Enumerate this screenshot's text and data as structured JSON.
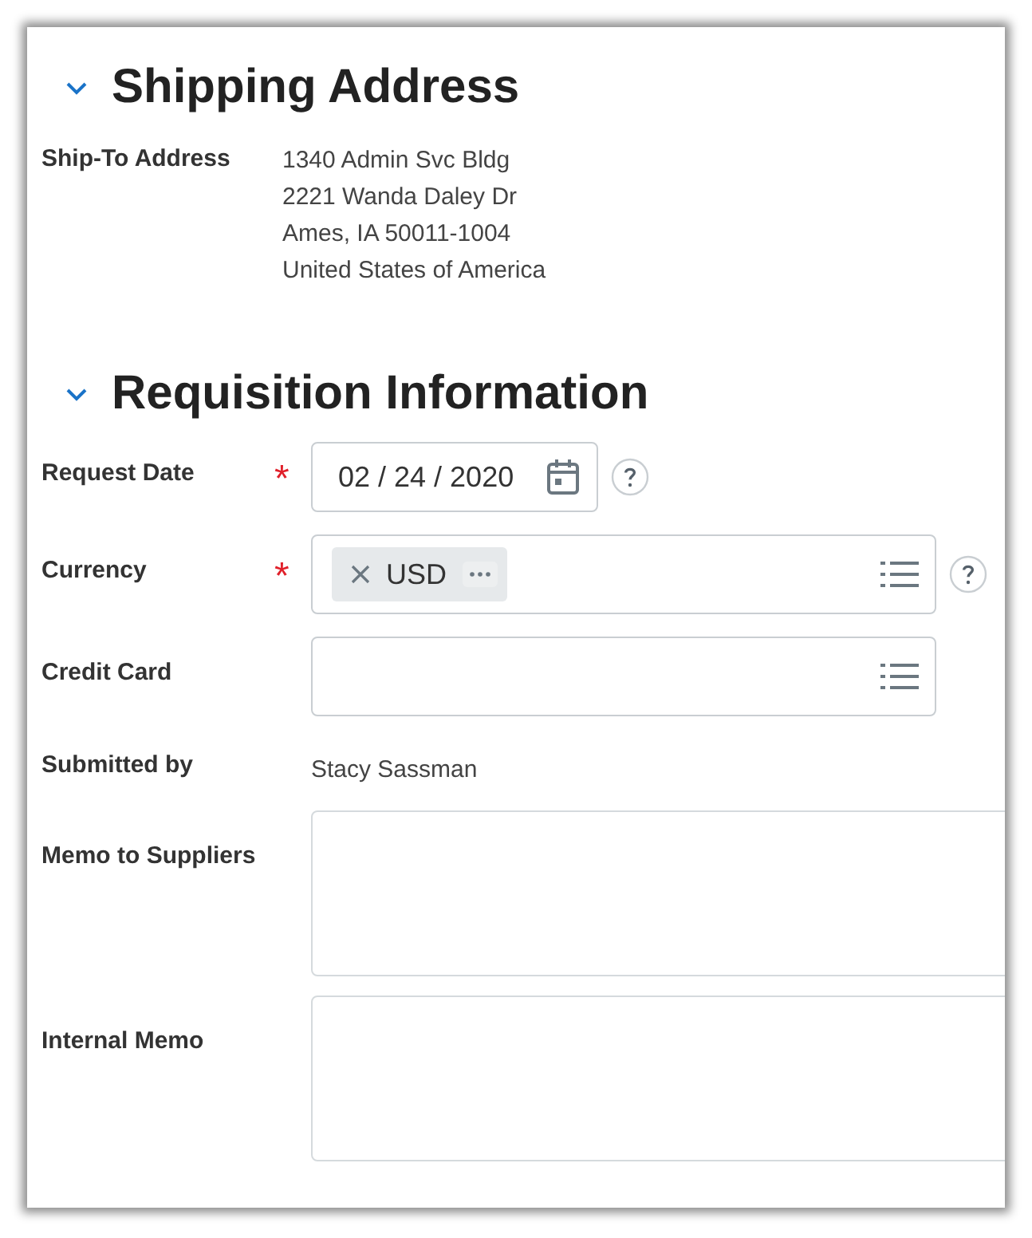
{
  "sections": [
    {
      "title": "Shipping Address",
      "expanded": true,
      "fields": [
        {
          "kind": "text",
          "label": "Ship-To Address",
          "lines": [
            "1340 Admin Svc Bldg",
            "2221 Wanda Daley Dr",
            "Ames, IA 50011-1004",
            "United States of America"
          ]
        }
      ]
    },
    {
      "title": "Requisition Information",
      "expanded": true,
      "fields": [
        {
          "kind": "date",
          "label": "Request Date",
          "required_mark": "*",
          "help": true,
          "value": "02 / 24 / 2020"
        },
        {
          "kind": "multiselect",
          "label": "Currency",
          "required_mark": "*",
          "help": true,
          "tokens": [
            "USD"
          ]
        },
        {
          "kind": "multiselect",
          "label": "Credit Card"
        },
        {
          "kind": "text",
          "label": "Submitted by",
          "lines": [
            "Stacy Sassman"
          ]
        },
        {
          "kind": "textarea",
          "label": "Memo to Suppliers"
        },
        {
          "kind": "textarea",
          "label": "Internal Memo"
        }
      ]
    }
  ]
}
